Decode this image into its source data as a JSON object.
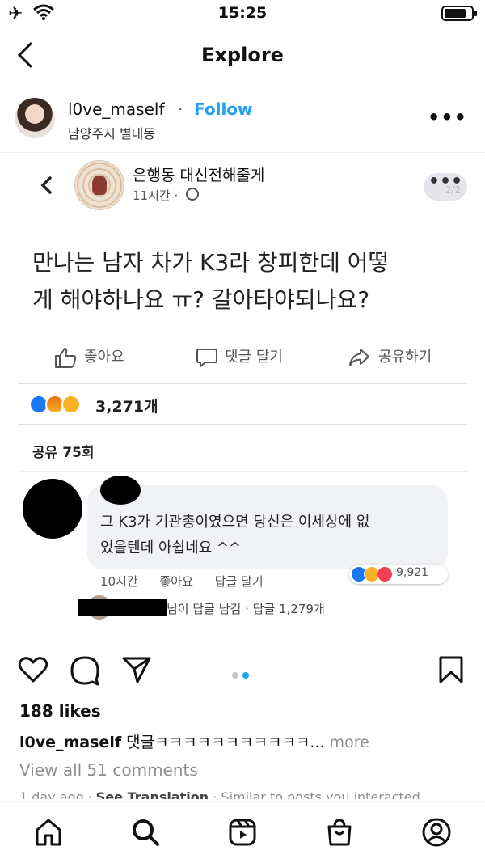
{
  "status_bar": {
    "time": "15:25"
  },
  "nav": {
    "title": "Explore"
  },
  "post": {
    "username": "l0ve_maself",
    "separator": "·",
    "follow_label": "Follow",
    "location": "남양주시 별내동",
    "more": "•••"
  },
  "facebook_post": {
    "page_name": "은행동 대신전해줄게",
    "time": "11시간 ·",
    "more": "•••",
    "more_fraction": "2/2",
    "body_line1": "만나는 남자 차가 K3라 창피한데 어떻",
    "body_line2": "게 해야하나요 ㅠ? 갈아타야되나요?",
    "actions": {
      "like": "좋아요",
      "comment": "댓글 달기",
      "share": "공유하기"
    },
    "reaction_count": "3,271개",
    "shares": "공유 75회",
    "comment": {
      "text_line1": "그 K3가 기관총이였으면 당신은 이세상에 없",
      "text_line2": "었을텐데 아쉽네요 ^^",
      "time": "10시간",
      "like": "좋아요",
      "reply": "답글 달기",
      "reaction_count": "9,921",
      "reply_summary": "님이 답글 남김 · 답글 1,279개"
    }
  },
  "likes": "188 likes",
  "caption": {
    "username": "l0ve_maself",
    "text": " 댓글ㅋㅋㅋㅋㅋㅋㅋㅋㅋㅋㅋ...",
    "more": " more"
  },
  "view_all": "View all 51 comments",
  "footer_line": {
    "time": "1 day ago",
    "sep1": " · ",
    "see_translation": "See Translation",
    "sep2": " · ",
    "similar": "Similar to posts you interacted"
  },
  "colors": {
    "accent": "#1da1f2",
    "facebook_blue": "#1877f2",
    "muted": "#8e8e8e"
  }
}
